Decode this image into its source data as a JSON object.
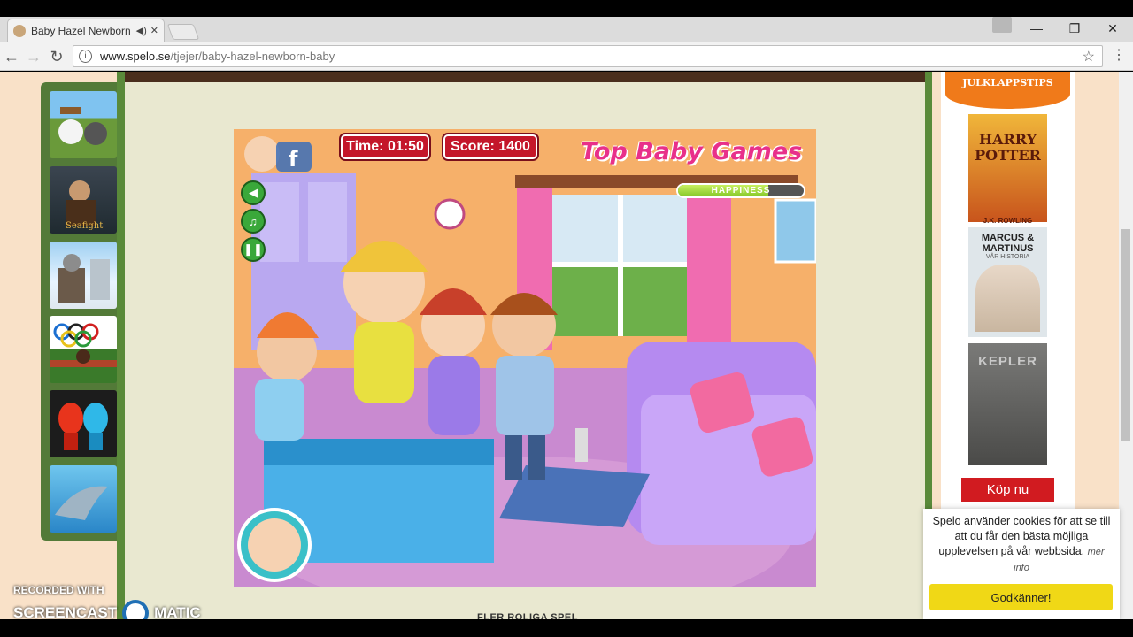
{
  "browser": {
    "tab_title": "Baby Hazel Newborn",
    "url_domain": "www.spelo.se",
    "url_path": "/tjejer/baby-hazel-newborn-baby"
  },
  "game": {
    "time_label": "Time: 01:50",
    "score_label": "Score: 1400",
    "brand": "Top Baby Games",
    "happiness_label": "HAPPINESS",
    "happiness_level": 0.72
  },
  "sidebar": {
    "banner_title": "JULKLAPPSTIPS",
    "buy_button": "Köp nu",
    "books": [
      {
        "title": "HARRY POTTER",
        "author": "J.K. ROWLING"
      },
      {
        "title": "MARCUS & MARTINUS",
        "subtitle": "VÅR HISTORIA"
      },
      {
        "title": "KEPLER"
      }
    ]
  },
  "cookie": {
    "text": "Spelo använder cookies för att se till att du får den bästa möjliga upplevelsen på vår webbsida.",
    "more": "mer info",
    "accept": "Godkänner!"
  },
  "page": {
    "bottom_link": "FLER ROLIGA SPEL"
  },
  "watermark": {
    "line1": "RECORDED WITH",
    "line2a": "SCREENCAST",
    "line2b": "MATIC"
  },
  "colors": {
    "accent_red": "#c4162a",
    "site_green": "#537a38",
    "cookie_yellow": "#f0d816"
  }
}
